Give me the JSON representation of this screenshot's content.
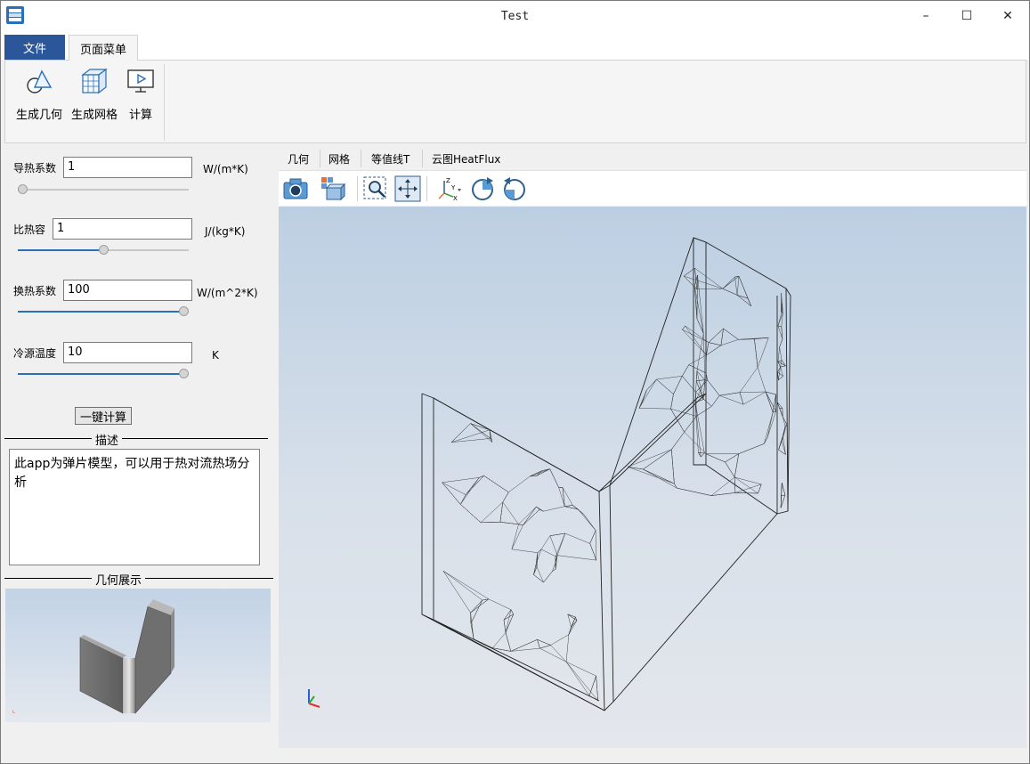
{
  "window": {
    "title": "Test",
    "minimize": "–",
    "maximize": "☐",
    "close": "✕"
  },
  "menu_tabs": {
    "file": "文件",
    "page_menu": "页面菜单"
  },
  "ribbon": {
    "buttons": [
      "生成几何",
      "生成网格",
      "计算"
    ]
  },
  "params": [
    {
      "label": "导热系数",
      "value": "1",
      "unit": "W/(m*K)",
      "slider": 0.0
    },
    {
      "label": "比热容",
      "value": "1",
      "unit": "J/(kg*K)",
      "slider": 0.5
    },
    {
      "label": "换热系数",
      "value": "100",
      "unit": "W/(m^2*K)",
      "slider": 1.0
    },
    {
      "label": "冷源温度",
      "value": "10",
      "unit": "K",
      "slider": 1.0
    }
  ],
  "calc_button": "一键计算",
  "description": {
    "header": "描述",
    "text": "此app为弹片模型，可以用于热对流热场分析"
  },
  "geometry_preview": {
    "header": "几何展示"
  },
  "viewer": {
    "tabs": [
      "几何",
      "网格",
      "等值线T",
      "云图HeatFlux"
    ],
    "toolbar_icons": [
      "camera-icon",
      "view-cube-icon",
      "zoom-box-icon",
      "fit-view-icon",
      "axes-icon",
      "rotate-cw-icon",
      "rotate-ccw-icon"
    ]
  },
  "colors": {
    "accent": "#2b579a",
    "slider_fill": "#2b6fb8"
  }
}
